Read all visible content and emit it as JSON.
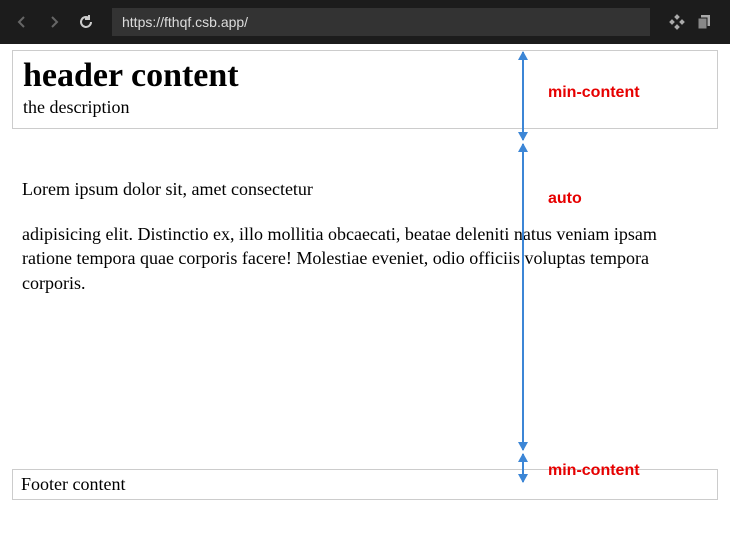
{
  "browser": {
    "url": "https://fthqf.csb.app/"
  },
  "header": {
    "title": "header content",
    "description": "the description"
  },
  "main": {
    "para1": "Lorem ipsum dolor sit, amet consectetur",
    "para2": "adipisicing elit. Distinctio ex, illo mollitia obcaecati, beatae deleniti natus veniam ipsam ratione tempora quae corporis facere! Molestiae eveniet, odio officiis voluptas tempora corporis."
  },
  "footer": {
    "content": "Footer content"
  },
  "annotations": {
    "label1": "min-content",
    "label2": "auto",
    "label3": "min-content"
  }
}
